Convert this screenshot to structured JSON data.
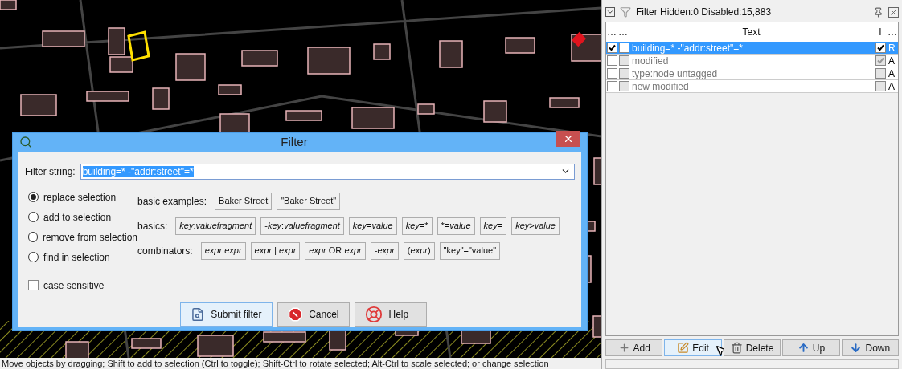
{
  "dialog": {
    "title": "Filter",
    "filter_label": "Filter string:",
    "filter_value": "building=* -\"addr:street\"=*",
    "value_highlighted": true,
    "modes": [
      {
        "label": "replace selection",
        "selected": true
      },
      {
        "label": "add to selection",
        "selected": false
      },
      {
        "label": "remove from selection",
        "selected": false
      },
      {
        "label": "find in selection",
        "selected": false
      }
    ],
    "case_sensitive": {
      "label": "case sensitive",
      "checked": false
    },
    "example_groups": [
      {
        "label": "basic examples:",
        "examples": [
          [
            {
              "text": "Baker Street",
              "italic": false
            }
          ],
          [
            {
              "text": "\"Baker Street\"",
              "italic": false
            }
          ]
        ]
      },
      {
        "label": "basics:",
        "examples": [
          [
            {
              "text": "key",
              "italic": true
            },
            {
              "text": ":",
              "italic": false
            },
            {
              "text": "valuefragment",
              "italic": true
            }
          ],
          [
            {
              "text": "-",
              "italic": false
            },
            {
              "text": "key",
              "italic": true
            },
            {
              "text": ":",
              "italic": false
            },
            {
              "text": "valuefragment",
              "italic": true
            }
          ],
          [
            {
              "text": "key",
              "italic": true
            },
            {
              "text": "=",
              "italic": false
            },
            {
              "text": "value",
              "italic": true
            }
          ],
          [
            {
              "text": "key",
              "italic": true
            },
            {
              "text": "=*",
              "italic": false
            }
          ],
          [
            {
              "text": "*=",
              "italic": false
            },
            {
              "text": "value",
              "italic": true
            }
          ],
          [
            {
              "text": "key",
              "italic": true
            },
            {
              "text": "=",
              "italic": false
            }
          ],
          [
            {
              "text": "key",
              "italic": true
            },
            {
              "text": ">",
              "italic": false
            },
            {
              "text": "value",
              "italic": true
            }
          ]
        ]
      },
      {
        "label": "combinators:",
        "examples": [
          [
            {
              "text": "expr expr",
              "italic": true
            }
          ],
          [
            {
              "text": "expr | expr",
              "italic": true
            }
          ],
          [
            {
              "text": "expr",
              "italic": true
            },
            {
              "text": " OR ",
              "italic": false
            },
            {
              "text": "expr",
              "italic": true
            }
          ],
          [
            {
              "text": "-",
              "italic": false
            },
            {
              "text": "expr",
              "italic": true
            }
          ],
          [
            {
              "text": "(",
              "italic": false
            },
            {
              "text": "expr",
              "italic": true
            },
            {
              "text": ")",
              "italic": false
            }
          ],
          [
            {
              "text": "\"key\"=\"value\"",
              "italic": false
            }
          ]
        ]
      }
    ],
    "buttons": [
      {
        "kind": "submit",
        "label": "Submit filter",
        "default": true
      },
      {
        "kind": "cancel",
        "label": "Cancel",
        "default": false
      },
      {
        "kind": "help",
        "label": "Help",
        "default": false
      }
    ]
  },
  "filter_panel": {
    "title": "Filter Hidden:0 Disabled:15,883",
    "columns": [
      "…",
      "…",
      "Text",
      "I",
      "…"
    ],
    "rows": [
      {
        "enabled": true,
        "hiding": false,
        "text": "building=* -\"addr:street\"=*",
        "inverted": true,
        "mode": "R",
        "selected": true
      },
      {
        "enabled": false,
        "hiding": false,
        "text": "modified",
        "inverted": true,
        "mode": "A",
        "selected": false
      },
      {
        "enabled": false,
        "hiding": false,
        "text": "type:node untagged",
        "inverted": false,
        "mode": "A",
        "selected": false
      },
      {
        "enabled": false,
        "hiding": false,
        "text": "new modified",
        "inverted": false,
        "mode": "A",
        "selected": false
      }
    ],
    "buttons": [
      {
        "kind": "add",
        "label": "Add",
        "hovered": false
      },
      {
        "kind": "edit",
        "label": "Edit",
        "hovered": true
      },
      {
        "kind": "delete",
        "label": "Delete",
        "hovered": false
      },
      {
        "kind": "up",
        "label": "Up",
        "hovered": false
      },
      {
        "kind": "down",
        "label": "Down",
        "hovered": false
      }
    ]
  },
  "status_bar": "Move objects by dragging; Shift to add to selection (Ctrl to toggle); Shift-Ctrl to rotate selected; Alt-Ctrl to scale selected; or change selection"
}
